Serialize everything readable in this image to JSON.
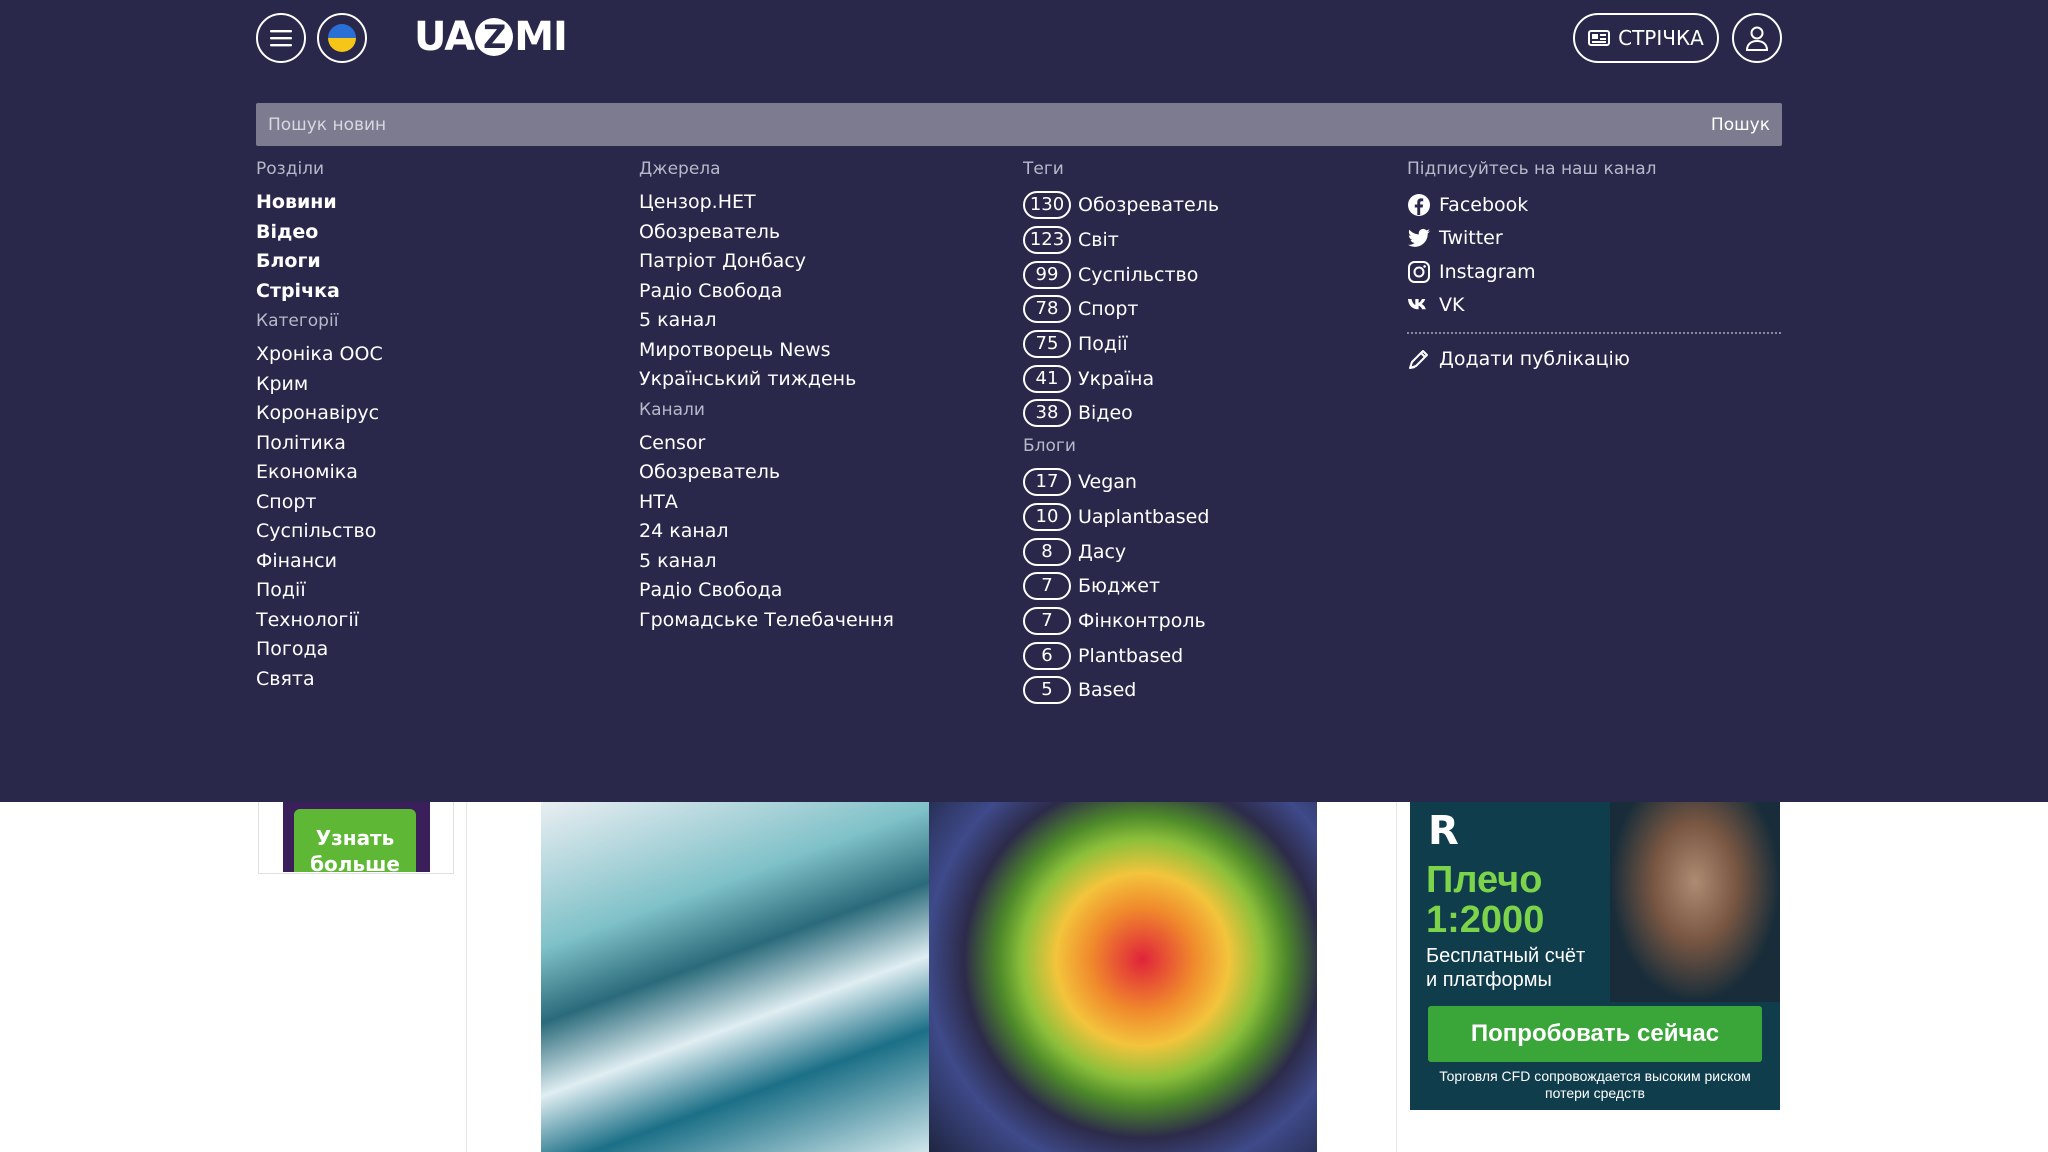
{
  "header": {
    "logo_text_left": "UA",
    "logo_text_mid": "Z",
    "logo_text_right": "MI",
    "feed_label": "СТРІЧКА"
  },
  "search": {
    "placeholder": "Пошук новин",
    "button_label": "Пошук"
  },
  "sections": {
    "heading": "Розділи",
    "items": [
      "Новини",
      "Відео",
      "Блоги",
      "Стрічка"
    ],
    "categories_heading": "Категорії",
    "categories": [
      "Хроніка ООС",
      "Крим",
      "Коронавірус",
      "Політика",
      "Економіка",
      "Спорт",
      "Суспільство",
      "Фінанси",
      "Події",
      "Технології",
      "Погода",
      "Свята"
    ]
  },
  "sources": {
    "heading": "Джерела",
    "items": [
      "Цензор.НЕТ",
      "Обозреватель",
      "Патріот Донбасу",
      "Радіо Свобода",
      "5 канал",
      "Миротворець News",
      "Український тиждень"
    ],
    "channels_heading": "Канали",
    "channels": [
      "Censor",
      "Обозреватель",
      "НТА",
      "24 канал",
      "5 канал",
      "Радіо Свобода",
      "Громадське Телебачення"
    ]
  },
  "tags": {
    "heading": "Теги",
    "items": [
      {
        "count": "130",
        "name": "Обозреватель"
      },
      {
        "count": "123",
        "name": "Світ"
      },
      {
        "count": "99",
        "name": "Суспільство"
      },
      {
        "count": "78",
        "name": "Спорт"
      },
      {
        "count": "75",
        "name": "Події"
      },
      {
        "count": "41",
        "name": "Україна"
      },
      {
        "count": "38",
        "name": "Відео"
      }
    ],
    "blogs_heading": "Блоги",
    "blogs": [
      {
        "count": "17",
        "name": "Vegan"
      },
      {
        "count": "10",
        "name": "Uaplantbased"
      },
      {
        "count": "8",
        "name": "Дасу"
      },
      {
        "count": "7",
        "name": "Бюджет"
      },
      {
        "count": "7",
        "name": "Фінконтроль"
      },
      {
        "count": "6",
        "name": "Plantbased"
      },
      {
        "count": "5",
        "name": "Based"
      }
    ]
  },
  "social": {
    "heading": "Підписуйтесь на наш канал",
    "items": [
      {
        "label": "Facebook",
        "icon": "facebook-icon"
      },
      {
        "label": "Twitter",
        "icon": "twitter-icon"
      },
      {
        "label": "Instagram",
        "icon": "instagram-icon"
      },
      {
        "label": "VK",
        "icon": "vk-icon"
      }
    ],
    "add_publication": "Додати публікацію"
  },
  "ads": {
    "left_button": "Узнать больше",
    "right_logo": "R",
    "right_headline_1": "Плечо",
    "right_headline_2": "1:2000",
    "right_text_1": "Бесплатный счёт",
    "right_text_2": "и платформы",
    "right_cta": "Попробовать сейчас",
    "right_disclaimer": "Торговля CFD сопровождается высоким риском потери средств"
  },
  "colors": {
    "menu_bg": "#29284a",
    "search_bg": "#7c7b8f",
    "ad_green": "#3aa63a"
  }
}
